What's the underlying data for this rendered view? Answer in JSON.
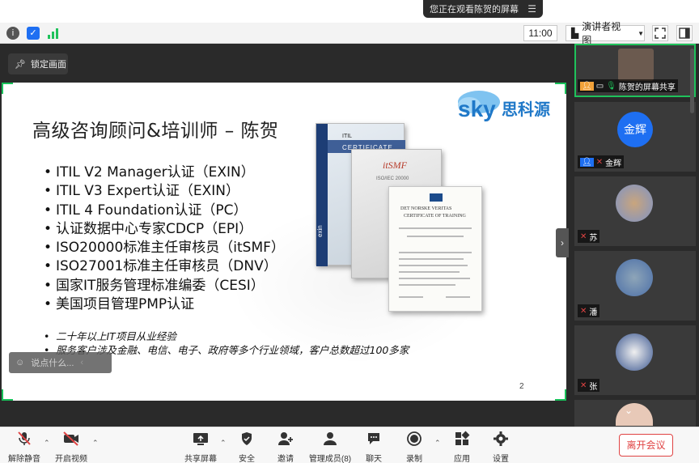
{
  "share_banner": {
    "text": "您正在观看陈贺的屏幕",
    "menu_icon": "menu-icon"
  },
  "toolbar": {
    "time": "11:00",
    "view_mode": "演讲者视图",
    "icons": [
      "info-icon",
      "shield-icon",
      "signal-icon",
      "fullscreen-icon",
      "sidebar-icon"
    ]
  },
  "stage": {
    "lock_label": "锁定画面",
    "say_placeholder": "说点什么...",
    "slide": {
      "title": "高级咨询顾问&培训师 – 陈贺",
      "logo_text": "Sky思科源",
      "bullets": [
        "ITIL V2 Manager认证（EXIN）",
        "ITIL V3 Expert认证（EXIN）",
        "ITIL 4 Foundation认证（PC）",
        "认证数据中心专家CDCP（EPI）",
        "ISO20000标准主任审核员（itSMF）",
        "ISO27001标准主任审核员（DNV）",
        "国家IT服务管理标准编委（CESI）",
        "美国项目管理PMP认证"
      ],
      "sub_bullets": [
        "二十年以上IT项目从业经验",
        "服务客户涉及金融、电信、电子、政府等多个行业领域，客户总数超过100多家"
      ],
      "page_number": "2",
      "certs": {
        "cert1_title": "ITIL",
        "cert1_banner": "CERTIFICATE",
        "cert1_brand": "exin",
        "cert2_title": "itSMF",
        "cert2_sub": "ISO/IEC 20000",
        "cert3_title": "DET NORSKE VERITAS",
        "cert3_sub": "CERTIFICATE OF TRAINING"
      }
    }
  },
  "participants": [
    {
      "name": "陈贺的屏幕共享",
      "avatar": "",
      "active": true
    },
    {
      "name": "金辉",
      "avatar": "金辉",
      "active": false
    },
    {
      "name": "苏",
      "avatar": "",
      "active": false
    },
    {
      "name": "潘",
      "avatar": "",
      "active": false
    },
    {
      "name": "张",
      "avatar": "",
      "active": false
    },
    {
      "name": "",
      "avatar": "",
      "active": false
    }
  ],
  "bottom_bar": {
    "mute": "解除静音",
    "video": "开启视频",
    "share": "共享屏幕",
    "security": "安全",
    "invite": "邀请",
    "members": "管理成员(8)",
    "chat": "聊天",
    "record": "录制",
    "apps": "应用",
    "settings": "设置",
    "leave": "离开会议"
  },
  "colors": {
    "active_border": "#1fc25b",
    "leave_red": "#e04343",
    "avatar_blue": "#1e6ff2"
  }
}
